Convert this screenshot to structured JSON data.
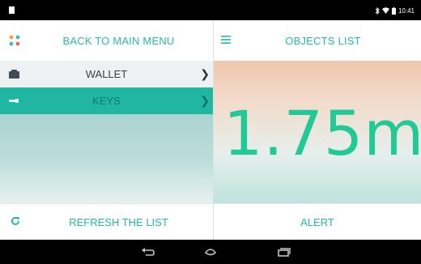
{
  "status_bar": {
    "time": "10:41",
    "icons": [
      "bluetooth-icon",
      "wifi-icon",
      "battery-icon"
    ]
  },
  "left_panel": {
    "back_label": "BACK TO MAIN MENU",
    "back_icon": "grid-icon",
    "items": [
      {
        "label": "WALLET",
        "icon": "wallet-icon",
        "selected": false
      },
      {
        "label": "KEYS",
        "icon": "key-icon",
        "selected": true
      }
    ],
    "refresh_label": "REFRESH THE LIST",
    "refresh_icon": "refresh-icon"
  },
  "right_panel": {
    "title": "OBJECTS LIST",
    "title_icon": "menu-icon",
    "distance": "1.75m",
    "alert_label": "ALERT"
  },
  "colors": {
    "accent": "#25b9a4",
    "selected_row": "#21b6a2",
    "distance_text": "#1fca97"
  },
  "nav_bar": {
    "buttons": [
      "back-icon",
      "home-icon",
      "recent-apps-icon"
    ]
  }
}
